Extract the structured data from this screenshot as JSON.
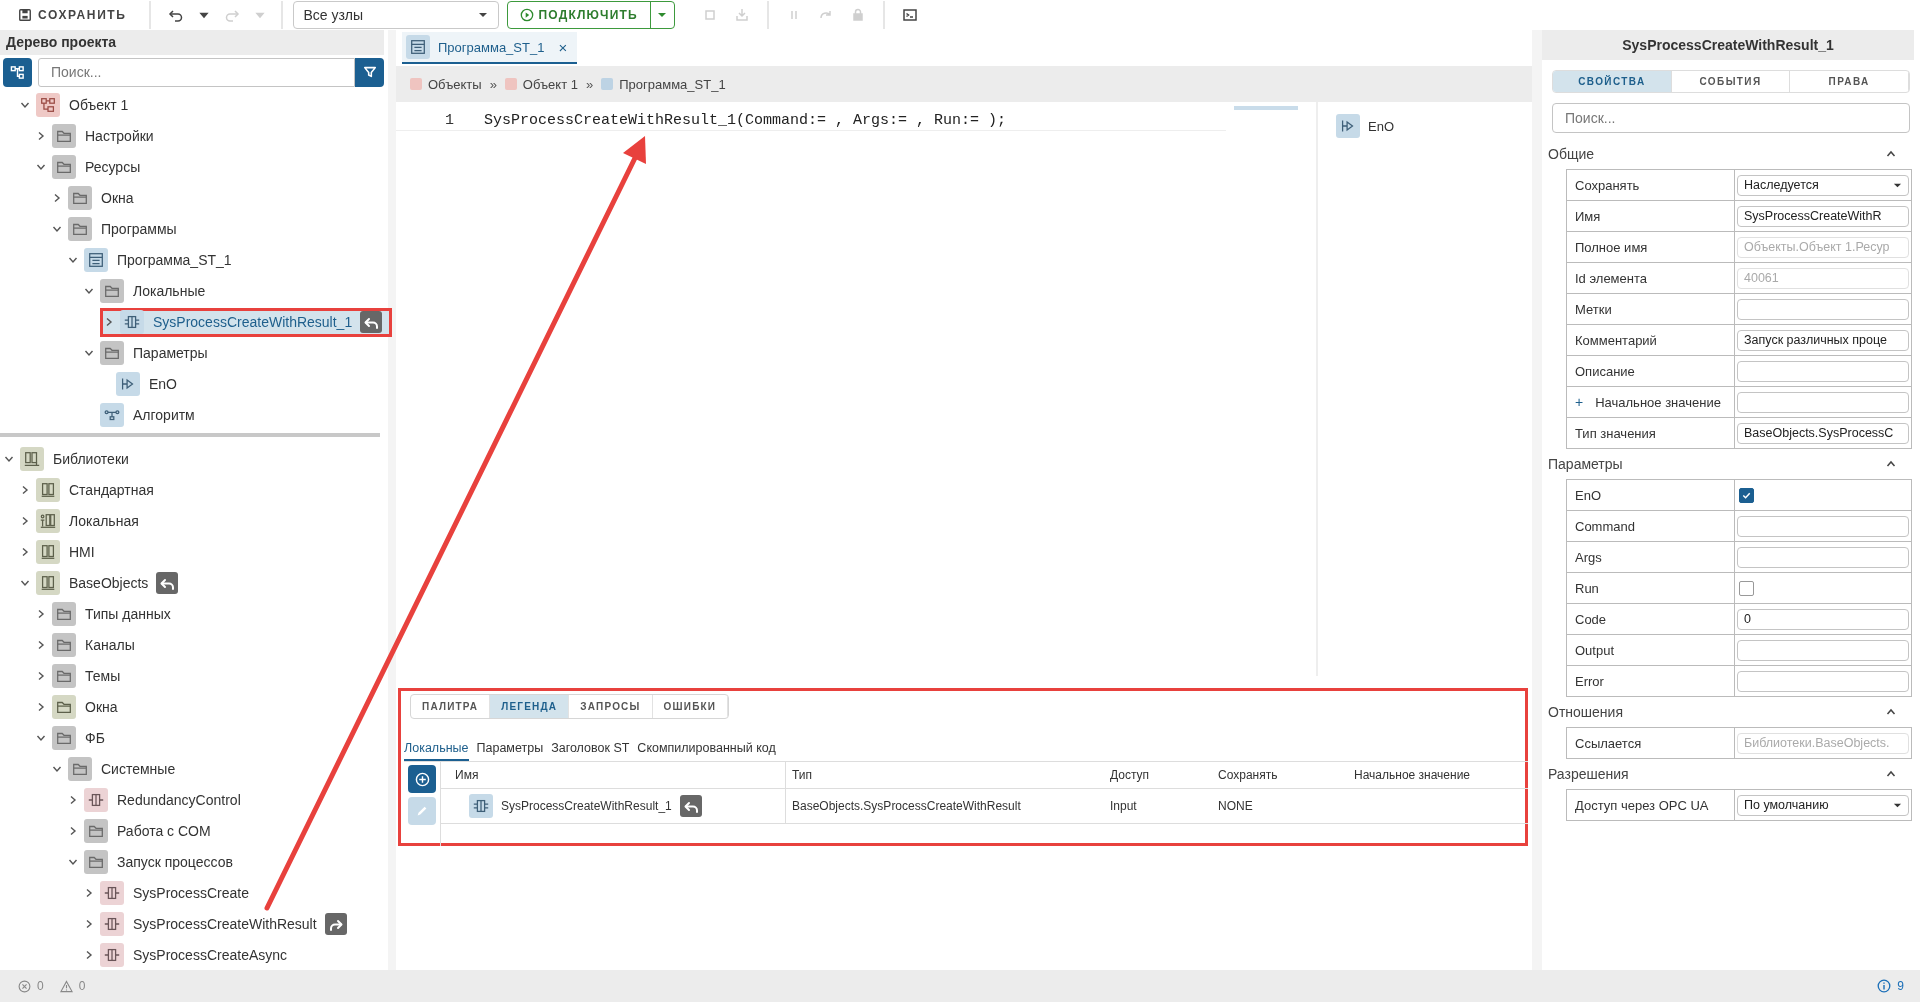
{
  "toolbar": {
    "save": {
      "label": "СОХРАНИТЬ"
    },
    "history": [
      {
        "kind": "undo",
        "disabled": false
      },
      {
        "kind": "dropdown",
        "disabled": false
      },
      {
        "kind": "redo",
        "disabled": true
      },
      {
        "kind": "dropdown",
        "disabled": true
      }
    ],
    "node_filter": {
      "value": "Все узлы"
    },
    "connect": {
      "label": "ПОДКЛЮЧИТЬ"
    },
    "action_groups": [
      [
        {
          "kind": "stop",
          "disabled": true
        },
        {
          "kind": "download",
          "disabled": true
        }
      ],
      [
        {
          "kind": "pause",
          "disabled": true
        },
        {
          "kind": "step",
          "disabled": true
        },
        {
          "kind": "lock",
          "disabled": true
        }
      ],
      [
        {
          "kind": "terminal",
          "disabled": false
        }
      ]
    ]
  },
  "project_panel": {
    "title": "Дерево проекта",
    "search_placeholder": "Поиск...",
    "project_tree": [
      {
        "label": "Объект 1",
        "kind": "object",
        "expanded": true,
        "selected": false,
        "children": [
          {
            "label": "Настройки",
            "kind": "folder",
            "expanded": false,
            "selected": false
          },
          {
            "label": "Ресурсы",
            "kind": "folder",
            "expanded": true,
            "selected": false,
            "children": [
              {
                "label": "Окна",
                "kind": "folder",
                "expanded": false,
                "selected": false
              },
              {
                "label": "Программы",
                "kind": "folder",
                "expanded": true,
                "selected": false,
                "children": [
                  {
                    "label": "Программа_ST_1",
                    "kind": "program",
                    "expanded": true,
                    "selected": false,
                    "children": [
                      {
                        "label": "Локальные",
                        "kind": "folder",
                        "expanded": true,
                        "selected": false,
                        "children": [
                          {
                            "label": "SysProcessCreateWithResult_1",
                            "kind": "fb-instance",
                            "expanded": false,
                            "selected": true,
                            "highlighted": true,
                            "badge": {
                              "kind": "back"
                            }
                          }
                        ]
                      },
                      {
                        "label": "Параметры",
                        "kind": "folder",
                        "expanded": true,
                        "selected": false,
                        "children": [
                          {
                            "label": "EnO",
                            "kind": "param",
                            "selected": false
                          }
                        ]
                      },
                      {
                        "label": "Алгоритм",
                        "kind": "algorithm",
                        "selected": false
                      }
                    ]
                  }
                ]
              }
            ]
          }
        ]
      }
    ],
    "library_tree": [
      {
        "label": "Библиотеки",
        "kind": "library",
        "expanded": true,
        "selected": false,
        "children": [
          {
            "label": "Стандартная",
            "kind": "library-book",
            "expanded": false,
            "selected": false
          },
          {
            "label": "Локальная",
            "kind": "library-local",
            "expanded": false,
            "selected": false
          },
          {
            "label": "HMI",
            "kind": "library-book",
            "expanded": false,
            "selected": false
          },
          {
            "label": "BaseObjects",
            "kind": "library-book",
            "expanded": true,
            "selected": false,
            "badge": {
              "kind": "back"
            },
            "children": [
              {
                "label": "Типы данных",
                "kind": "folder",
                "expanded": false,
                "selected": false
              },
              {
                "label": "Каналы",
                "kind": "folder",
                "expanded": false,
                "selected": false
              },
              {
                "label": "Темы",
                "kind": "folder",
                "expanded": false,
                "selected": false
              },
              {
                "label": "Окна",
                "kind": "lib-folder",
                "expanded": false,
                "selected": false
              },
              {
                "label": "ФБ",
                "kind": "folder",
                "expanded": true,
                "selected": false,
                "children": [
                  {
                    "label": "Системные",
                    "kind": "folder",
                    "expanded": true,
                    "selected": false,
                    "children": [
                      {
                        "label": "RedundancyControl",
                        "kind": "fb",
                        "expanded": false,
                        "selected": false
                      },
                      {
                        "label": "Работа с COM",
                        "kind": "folder",
                        "expanded": false,
                        "selected": false
                      },
                      {
                        "label": "Запуск процессов",
                        "kind": "folder",
                        "expanded": true,
                        "selected": false,
                        "children": [
                          {
                            "label": "SysProcessCreate",
                            "kind": "fb",
                            "expanded": false,
                            "selected": false
                          },
                          {
                            "label": "SysProcessCreateWithResult",
                            "kind": "fb",
                            "expanded": false,
                            "selected": false,
                            "badge": {
                              "kind": "forward"
                            }
                          },
                          {
                            "label": "SysProcessCreateAsync",
                            "kind": "fb",
                            "expanded": false,
                            "selected": false
                          }
                        ]
                      }
                    ]
                  }
                ]
              }
            ]
          }
        ]
      }
    ]
  },
  "editor": {
    "tabs": [
      {
        "label": "Программа_ST_1",
        "close": "×",
        "selected": true
      }
    ],
    "breadcrumbs": [
      {
        "label": "Объекты",
        "color": "#efc4c0"
      },
      {
        "separator": "»",
        "label": "Объект 1",
        "color": "#efc4c0"
      },
      {
        "separator": "»",
        "label": "Программа_ST_1",
        "color": "#bdd3e4"
      }
    ],
    "code_lines": [
      {
        "number": "1",
        "text": "SysProcessCreateWithResult_1(Command:= , Args:= , Run:= );"
      }
    ],
    "outline": [
      {
        "label": "EnO",
        "kind": "param"
      }
    ]
  },
  "bottom_panel": {
    "highlighted": true,
    "tabs": [
      {
        "label": "ПАЛИТРА",
        "selected": false
      },
      {
        "label": "ЛЕГЕНДА",
        "selected": true
      },
      {
        "label": "ЗАПРОСЫ",
        "selected": false
      },
      {
        "label": "ОШИБКИ",
        "selected": false
      }
    ],
    "subtabs": [
      {
        "label": "Локальные",
        "selected": true
      },
      {
        "label": "Параметры",
        "selected": false
      },
      {
        "label": "Заголовок ST",
        "selected": false
      },
      {
        "label": "Скомпилированный код",
        "selected": false
      }
    ],
    "side_buttons": [
      {
        "kind": "add",
        "disabled": false
      },
      {
        "kind": "edit",
        "disabled": true
      }
    ],
    "columns": [
      "Имя",
      "Тип",
      "Доступ",
      "Сохранять",
      "Начальное значение"
    ],
    "rows": [
      {
        "name": "SysProcessCreateWithResult_1",
        "kind": "fb-instance",
        "badge": {
          "kind": "back"
        },
        "type": "BaseObjects.SysProcessCreateWithResult",
        "access": "Input",
        "save": "NONE"
      }
    ]
  },
  "properties": {
    "title": "SysProcessCreateWithResult_1",
    "tabs": [
      {
        "label": "СВОЙСТВА",
        "selected": true
      },
      {
        "label": "СОБЫТИЯ",
        "selected": false
      },
      {
        "label": "ПРАВА",
        "selected": false
      }
    ],
    "search_placeholder": "Поиск...",
    "sections": [
      {
        "title": "Общие",
        "expanded": true,
        "rows": [
          {
            "label": "Сохранять",
            "kind": "select",
            "value": "Наследуется"
          },
          {
            "label": "Имя",
            "kind": "input",
            "value": "SysProcessCreateWithR"
          },
          {
            "label": "Полное имя",
            "kind": "readonly",
            "value": "Объекты.Объект 1.Ресур"
          },
          {
            "label": "Id элемента",
            "kind": "readonly",
            "value": "40061"
          },
          {
            "label": "Метки",
            "kind": "input"
          },
          {
            "label": "Комментарий",
            "kind": "input",
            "value": "Запуск различных проце"
          },
          {
            "label": "Описание",
            "kind": "input"
          },
          {
            "label": "Начальное значение",
            "kind": "input",
            "expand": "+"
          },
          {
            "label": "Тип значения",
            "kind": "input",
            "value": "BaseObjects.SysProcessC"
          }
        ]
      },
      {
        "title": "Параметры",
        "expanded": true,
        "rows": [
          {
            "label": "EnO",
            "kind": "checkbox",
            "checked": true
          },
          {
            "label": "Command",
            "kind": "input"
          },
          {
            "label": "Args",
            "kind": "input"
          },
          {
            "label": "Run",
            "kind": "checkbox",
            "checked": false
          },
          {
            "label": "Code",
            "kind": "input",
            "value": "0"
          },
          {
            "label": "Output",
            "kind": "input"
          },
          {
            "label": "Error",
            "kind": "input"
          }
        ]
      },
      {
        "title": "Отношения",
        "expanded": true,
        "rows": [
          {
            "label": "Ссылается",
            "kind": "readonly",
            "value": "Библиотеки.BaseObjects."
          }
        ]
      },
      {
        "title": "Разрешения",
        "expanded": true,
        "rows": [
          {
            "label": "Доступ через OPC UA",
            "kind": "select",
            "value": "По умолчанию"
          }
        ]
      }
    ]
  },
  "status_bar": {
    "errors": "0",
    "warnings": "0",
    "info": "9"
  },
  "callout_arrow": true
}
